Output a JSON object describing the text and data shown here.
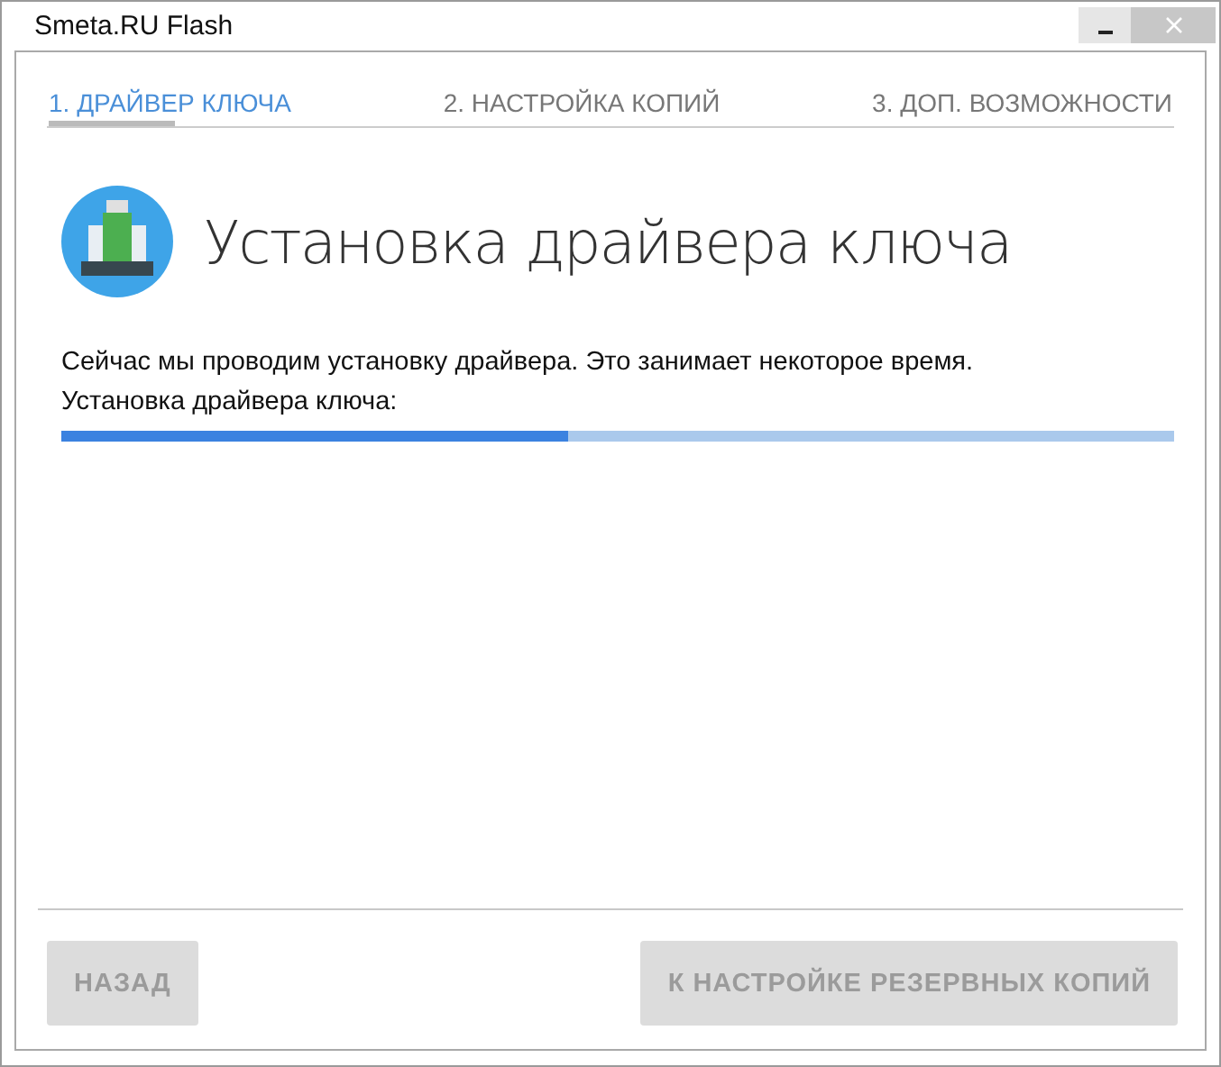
{
  "window": {
    "title": "Smeta.RU Flash"
  },
  "steps": [
    {
      "label": "1. ДРАЙВЕР КЛЮЧА",
      "selected": true
    },
    {
      "label": "2. НАСТРОЙКА КОПИЙ",
      "selected": false
    },
    {
      "label": "3. ДОП. ВОЗМОЖНОСТИ",
      "selected": false
    }
  ],
  "heading": "Установка драйвера ключа",
  "description": "Сейчас мы проводим установку драйвера. Это занимает некоторое время.",
  "progress": {
    "label": "Установка драйвера ключа:",
    "level": 0.455
  },
  "buttons": [
    {
      "label": "НАЗАД",
      "disabled": true
    },
    {
      "label": "К НАСТРОЙКЕ РЕЗЕРВНЫХ КОПИЙ",
      "disabled": true
    }
  ]
}
